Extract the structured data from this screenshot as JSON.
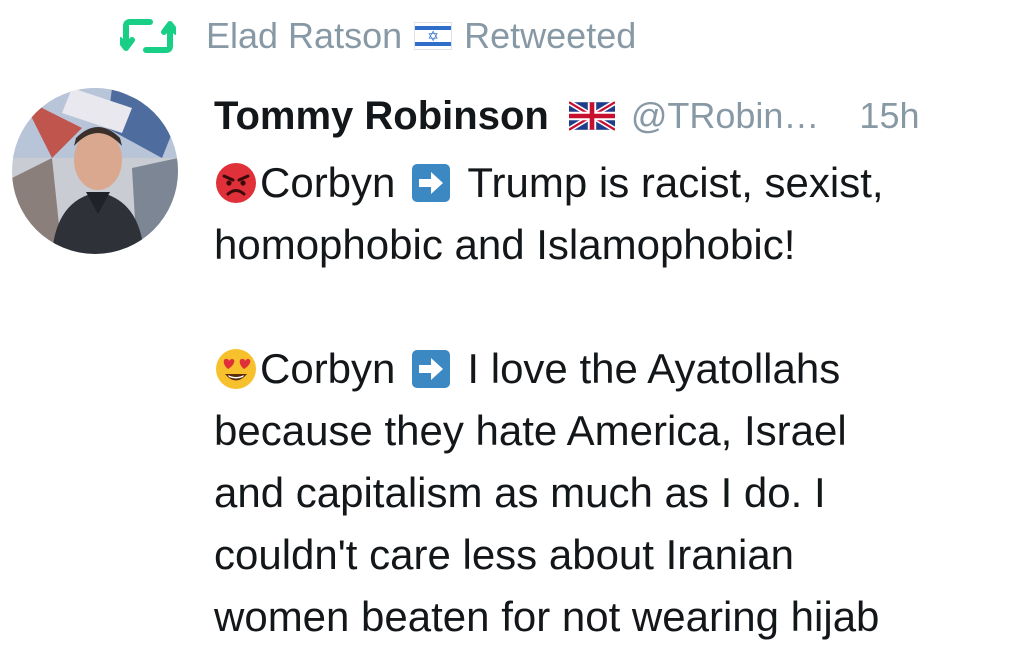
{
  "retweet": {
    "icon": "retweet-icon",
    "user": "Elad Ratson",
    "flag": "israel-flag-icon",
    "label": "Retweeted"
  },
  "tweet": {
    "author_name": "Tommy Robinson",
    "author_flag": "uk-flag-icon",
    "handle": "@TRobin…",
    "time": "15h",
    "lines": {
      "l1_emoji": "angry-face-icon",
      "l1_word": "Corbyn",
      "l1_arrow": "right-arrow-icon",
      "l1_text": "Trump is racist, sexist,",
      "l2_text": "homophobic and Islamophobic!",
      "l3_emoji": "heart-eyes-face-icon",
      "l3_word": "Corbyn",
      "l3_arrow": "right-arrow-icon",
      "l3_text": "I love the Ayatollahs",
      "l4_text": "because they hate America, Israel",
      "l5_text": "and capitalism as much as I do. I",
      "l6_text": "couldn't care less about Iranian",
      "l7_text": "women beaten for not wearing hijab"
    }
  },
  "colors": {
    "retweet_green": "#19cf86",
    "muted": "#8899a6",
    "text": "#14171a",
    "arrow_blue": "#3b88c3"
  }
}
